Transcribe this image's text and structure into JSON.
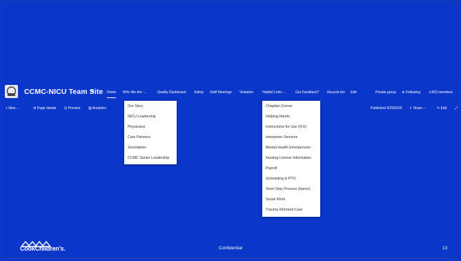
{
  "site": {
    "title": "CCMC-NICU Team Site",
    "title_icon": "sharepoint-sync-icon",
    "logo_icon": "site-logo-icon"
  },
  "nav": {
    "home": "Home",
    "who_we_are": "Who We Are",
    "quality_dashboard": "Quality Dashboard",
    "safety": "Safety",
    "staff_meetings": "Staff Meetings",
    "visitation": "Visitation",
    "helpful_links": "Helpful Links",
    "got_feedback": "Got Feedback?",
    "recycle_bin": "Recycle bin",
    "edit": "Edit"
  },
  "header_right": {
    "private_group": "Private group",
    "following": "Following",
    "members": "553 members"
  },
  "commandbar": {
    "new": "New",
    "page_details": "Page details",
    "preview": "Preview",
    "analytics": "Analytics",
    "published": "Published 5/29/2026",
    "share": "Share",
    "edit": "Edit"
  },
  "who_we_are_menu": [
    "Our Story",
    "NICU Leadership",
    "Physicians",
    "Care Partners",
    "Secretaries",
    "CCMC Senior Leadership"
  ],
  "helpful_links_menu": [
    "Chaplain Corner",
    "Helping Hands",
    "Instructions for Use (IFU)",
    "Interpreter Services",
    "Mental Health Emergencies",
    "Nursing License Information",
    "Payroll",
    "Scheduling & PTO",
    "Short Stay Process (Harris)",
    "Social Work",
    "Trauma Informed Care"
  ],
  "footer": {
    "brand": "CookChildren's.",
    "center": "Confidential",
    "page_number": "13"
  },
  "colors": {
    "slide_bg": "#0a36c9",
    "menu_bg": "#ffffff",
    "menu_text": "#2c2c2c"
  }
}
